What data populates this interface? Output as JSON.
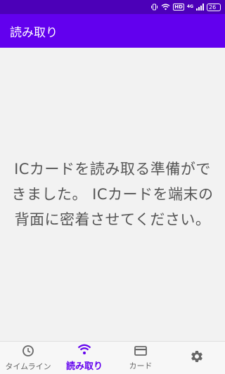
{
  "status_bar": {
    "vibrate_icon": "vibrate-icon",
    "wifi_icon": "wifi-icon",
    "hd_label": "HD",
    "network_label": "4G",
    "signal_icon": "signal-icon",
    "battery_level": "26"
  },
  "app_bar": {
    "title": "読み取り"
  },
  "main": {
    "message": "ICカードを読み取る準備ができました。 ICカードを端末の背面に密着させてください。"
  },
  "bottom_nav": {
    "items": [
      {
        "label": "タイムライン",
        "icon": "clock-icon",
        "active": false
      },
      {
        "label": "読み取り",
        "icon": "wifi-icon",
        "active": true
      },
      {
        "label": "カード",
        "icon": "card-icon",
        "active": false
      },
      {
        "label": "",
        "icon": "gear-icon",
        "active": false
      }
    ]
  },
  "colors": {
    "status_bar": "#4c00b8",
    "app_bar": "#6200ee",
    "accent": "#6200ee",
    "text": "#555555"
  }
}
